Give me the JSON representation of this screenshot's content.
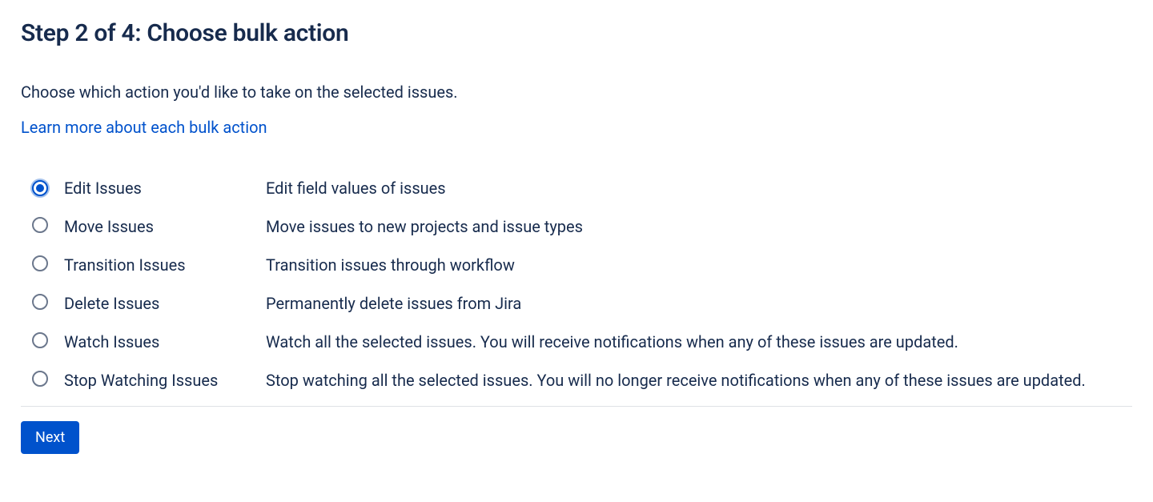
{
  "header": {
    "title": "Step 2 of 4: Choose bulk action"
  },
  "intro": {
    "description": "Choose which action you'd like to take on the selected issues.",
    "learn_more": "Learn more about each bulk action"
  },
  "options": [
    {
      "label": "Edit Issues",
      "description": "Edit field values of issues",
      "selected": true
    },
    {
      "label": "Move Issues",
      "description": "Move issues to new projects and issue types",
      "selected": false
    },
    {
      "label": "Transition Issues",
      "description": "Transition issues through workflow",
      "selected": false
    },
    {
      "label": "Delete Issues",
      "description": "Permanently delete issues from Jira",
      "selected": false
    },
    {
      "label": "Watch Issues",
      "description": "Watch all the selected issues. You will receive notifications when any of these issues are updated.",
      "selected": false
    },
    {
      "label": "Stop Watching Issues",
      "description": "Stop watching all the selected issues. You will no longer receive notifications when any of these issues are updated.",
      "selected": false
    }
  ],
  "footer": {
    "next_label": "Next"
  }
}
